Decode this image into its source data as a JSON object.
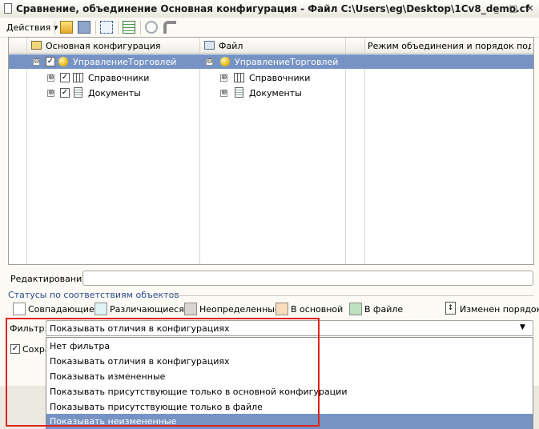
{
  "window": {
    "title": "Сравнение, объединение Основная конфигурация - Файл C:\\Users\\eg\\Desktop\\1Cv8_demo.cf",
    "minimize_glyph": "_",
    "maximize_glyph": "□",
    "close_glyph": "✕"
  },
  "toolbar": {
    "actions_label": "Действия ▾"
  },
  "grid": {
    "headers": {
      "main_config": "Основная конфигурация",
      "file": "Файл",
      "merge_mode": "Режим объединения и порядок подчи..."
    },
    "rows": [
      {
        "expander": "⊖",
        "left_label": "УправлениеТорговлей",
        "right_label": "УправлениеТорговлей"
      },
      {
        "expander": "⊕",
        "left_label": "Справочники",
        "right_label": "Справочники"
      },
      {
        "expander": "⊕",
        "left_label": "Документы",
        "right_label": "Документы"
      }
    ]
  },
  "editing": {
    "label": "Редактирование:",
    "value": ""
  },
  "statuses": {
    "group_title": "Статусы по соответствиям объектов",
    "items": [
      {
        "label": "Совпадающие",
        "color": "#ffffff"
      },
      {
        "label": "Различающиеся",
        "color": "#dff3f7"
      },
      {
        "label": "Неопределенные",
        "color": "#d8d6d2"
      },
      {
        "label": "В основной",
        "color": "#f9dcbc"
      },
      {
        "label": "В файле",
        "color": "#bfe0bf"
      }
    ],
    "order_changed": "Изменен порядок"
  },
  "filter": {
    "label": "Фильтр:",
    "value": "Показывать отличия в конфигурациях",
    "options": [
      "Нет фильтра",
      "Показывать отличия в конфигурациях",
      "Показывать измененные",
      "Показывать присутствующие только в основной конфигурации",
      "Показывать присутствующие только в файле",
      "Показывать неизмененные"
    ],
    "highlighted_index": 5
  },
  "save": {
    "label": "Сохра"
  },
  "colors": {
    "selection": "#7693c4",
    "highlight_box": "#e0231c"
  }
}
